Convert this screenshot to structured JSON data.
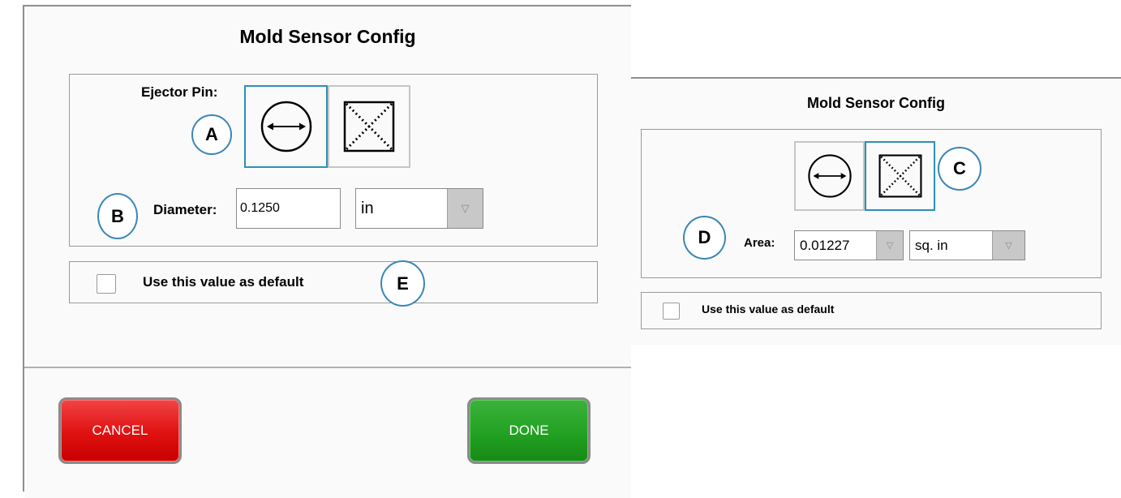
{
  "left_dialog": {
    "title": "Mold Sensor Config",
    "ejector_pin_label": "Ejector Pin:",
    "diameter_label": "Diameter:",
    "diameter_value": "0.1250",
    "diameter_unit": "in",
    "default_checkbox_label": "Use this value as default",
    "default_checked": false,
    "cancel_label": "CANCEL",
    "done_label": "DONE",
    "selected_shape": "diameter"
  },
  "right_dialog": {
    "title": "Mold Sensor Config",
    "area_label": "Area:",
    "area_value": "0.01227",
    "area_unit": "sq. in",
    "default_checkbox_label": "Use this value as default",
    "default_checked": false,
    "selected_shape": "area"
  },
  "callouts": {
    "a": "A",
    "b": "B",
    "c": "C",
    "d": "D",
    "e": "E"
  },
  "icons": {
    "diameter": "circle-double-arrow-icon",
    "area": "dotted-cross-box-icon",
    "dropdown": "triangle-down-icon"
  },
  "colors": {
    "selected_border": "#2b90b8",
    "callout_border": "#3a86b6",
    "cancel_button": "#e01010",
    "done_button": "#22a122"
  }
}
